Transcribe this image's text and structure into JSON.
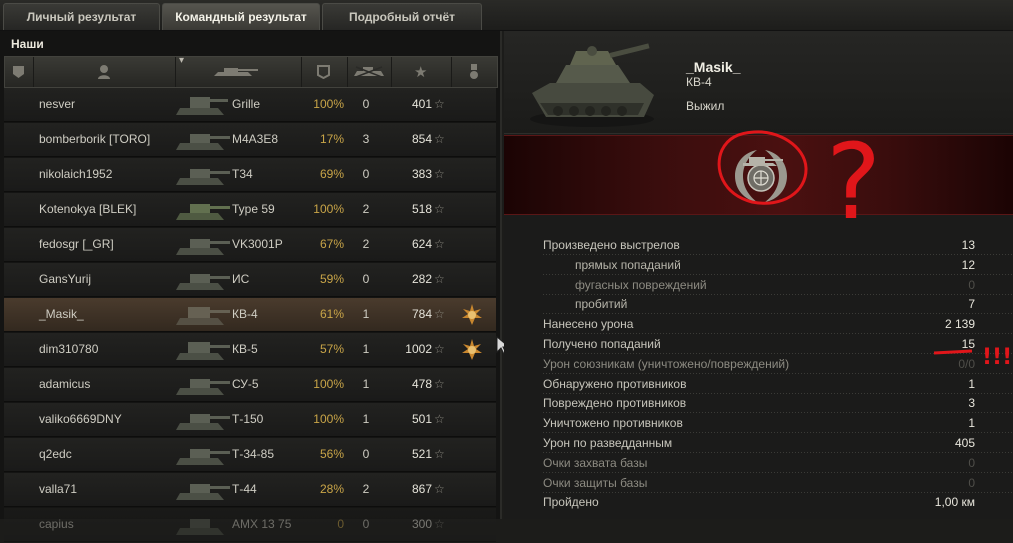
{
  "tabs": [
    {
      "label": "Личный результат",
      "active": false
    },
    {
      "label": "Командный результат",
      "active": true
    },
    {
      "label": "Подробный отчёт",
      "active": false
    }
  ],
  "team": {
    "title": "Наши",
    "rows": [
      {
        "name": "nesver",
        "tank": "Grille",
        "hp": "100%",
        "kills": "0",
        "xp": "401",
        "medal": false,
        "me": false
      },
      {
        "name": "bomberborik [TORO]",
        "tank": "M4A3E8",
        "hp": "17%",
        "kills": "3",
        "xp": "854",
        "medal": false,
        "me": false
      },
      {
        "name": "nikolaich1952",
        "tank": "T34",
        "hp": "69%",
        "kills": "0",
        "xp": "383",
        "medal": false,
        "me": false
      },
      {
        "name": "Kotenokya [BLEK]",
        "tank": "Type 59",
        "hp": "100%",
        "kills": "2",
        "xp": "518",
        "medal": false,
        "me": false
      },
      {
        "name": "fedosgr [_GR]",
        "tank": "VK3001P",
        "hp": "67%",
        "kills": "2",
        "xp": "624",
        "medal": false,
        "me": false
      },
      {
        "name": "GansYurij",
        "tank": "ИС",
        "hp": "59%",
        "kills": "0",
        "xp": "282",
        "medal": false,
        "me": false
      },
      {
        "name": "_Masik_",
        "tank": "КВ-4",
        "hp": "61%",
        "kills": "1",
        "xp": "784",
        "medal": true,
        "me": true
      },
      {
        "name": "dim310780",
        "tank": "КВ-5",
        "hp": "57%",
        "kills": "1",
        "xp": "1002",
        "medal": true,
        "me": false
      },
      {
        "name": "adamicus",
        "tank": "СУ-5",
        "hp": "100%",
        "kills": "1",
        "xp": "478",
        "medal": false,
        "me": false
      },
      {
        "name": "valiko6669DNY",
        "tank": "Т-150",
        "hp": "100%",
        "kills": "1",
        "xp": "501",
        "medal": false,
        "me": false
      },
      {
        "name": "q2edc",
        "tank": "Т-34-85",
        "hp": "56%",
        "kills": "0",
        "xp": "521",
        "medal": false,
        "me": false
      },
      {
        "name": "valla71",
        "tank": "Т-44",
        "hp": "28%",
        "kills": "2",
        "xp": "867",
        "medal": false,
        "me": false
      },
      {
        "name": "capius",
        "tank": "AMX 13 75",
        "hp": "0",
        "kills": "0",
        "xp": "300",
        "medal": false,
        "me": false,
        "dim": true
      }
    ]
  },
  "player": {
    "name": "_Masik_",
    "vehicle": "КВ-4",
    "status": "Выжил"
  },
  "stats": [
    {
      "label": "Произведено выстрелов",
      "value": "13",
      "sub": false,
      "zero": false
    },
    {
      "label": "прямых попаданий",
      "value": "12",
      "sub": true,
      "zero": false
    },
    {
      "label": "фугасных повреждений",
      "value": "0",
      "sub": true,
      "zero": true
    },
    {
      "label": "пробитий",
      "value": "7",
      "sub": true,
      "zero": false
    },
    {
      "label": "Нанесено урона",
      "value": "2 139",
      "sub": false,
      "zero": false
    },
    {
      "label": "Получено попаданий",
      "value": "15",
      "sub": false,
      "zero": false
    },
    {
      "label": "Урон союзникам (уничтожено/повреждений)",
      "value": "0/0",
      "sub": false,
      "zero": true
    },
    {
      "label": "Обнаружено противников",
      "value": "1",
      "sub": false,
      "zero": false
    },
    {
      "label": "Повреждено противников",
      "value": "3",
      "sub": false,
      "zero": false
    },
    {
      "label": "Уничтожено противников",
      "value": "1",
      "sub": false,
      "zero": false
    },
    {
      "label": "Урон по разведданным",
      "value": "405",
      "sub": false,
      "zero": false
    },
    {
      "label": "Очки захвата базы",
      "value": "0",
      "sub": false,
      "zero": true
    },
    {
      "label": "Очки защиты базы",
      "value": "0",
      "sub": false,
      "zero": true
    },
    {
      "label": "Пройдено",
      "value": "1,00 км",
      "sub": false,
      "zero": false
    }
  ],
  "icons": {
    "header": [
      "vehicle-type-icon",
      "player-icon",
      "tank-icon",
      "health-icon",
      "kills-icon",
      "xp-star-icon",
      "medal-icon"
    ]
  },
  "annotation": {
    "question_mark": "?",
    "exclamation": "!!!"
  },
  "colors": {
    "accent_gold": "#c9a548",
    "annotation_red": "#e0161a"
  }
}
